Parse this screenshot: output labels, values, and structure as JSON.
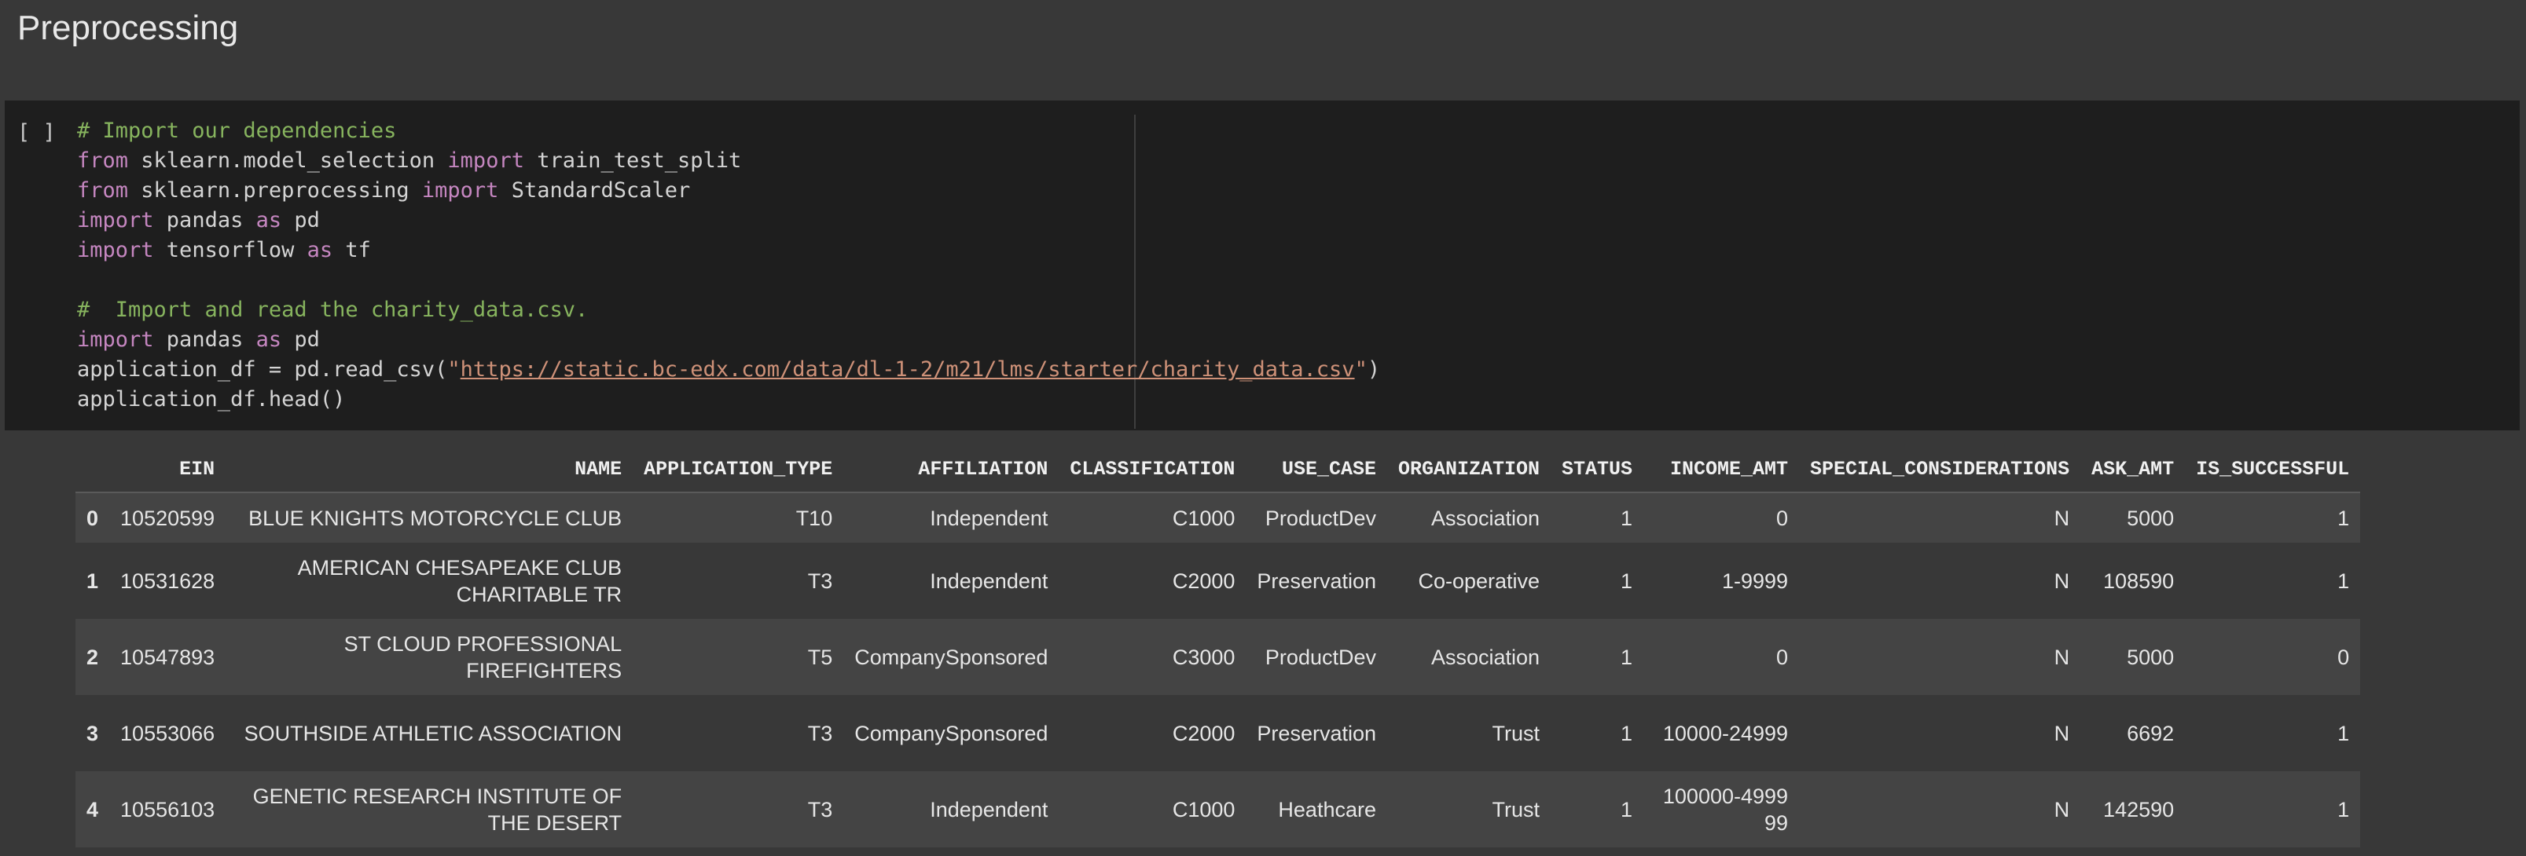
{
  "section": {
    "title": "Preprocessing"
  },
  "cell": {
    "run_indicator": "[ ]",
    "code_lines": [
      [
        {
          "t": "comment",
          "v": "# Import our dependencies"
        }
      ],
      [
        {
          "t": "kw",
          "v": "from"
        },
        {
          "t": "plain",
          "v": " sklearn.model_selection "
        },
        {
          "t": "kw",
          "v": "import"
        },
        {
          "t": "plain",
          "v": " train_test_split"
        }
      ],
      [
        {
          "t": "kw",
          "v": "from"
        },
        {
          "t": "plain",
          "v": " sklearn.preprocessing "
        },
        {
          "t": "kw",
          "v": "import"
        },
        {
          "t": "plain",
          "v": " StandardScaler"
        }
      ],
      [
        {
          "t": "kw",
          "v": "import"
        },
        {
          "t": "plain",
          "v": " pandas "
        },
        {
          "t": "kw",
          "v": "as"
        },
        {
          "t": "plain",
          "v": " pd"
        }
      ],
      [
        {
          "t": "kw",
          "v": "import"
        },
        {
          "t": "plain",
          "v": " tensorflow "
        },
        {
          "t": "kw",
          "v": "as"
        },
        {
          "t": "plain",
          "v": " tf"
        }
      ],
      [],
      [
        {
          "t": "comment",
          "v": "#  Import and read the charity_data.csv."
        }
      ],
      [
        {
          "t": "kw",
          "v": "import"
        },
        {
          "t": "plain",
          "v": " pandas "
        },
        {
          "t": "kw",
          "v": "as"
        },
        {
          "t": "plain",
          "v": " pd"
        }
      ],
      [
        {
          "t": "plain",
          "v": "application_df = pd.read_csv("
        },
        {
          "t": "str",
          "v": "\""
        },
        {
          "t": "url",
          "v": "https://static.bc-edx.com/data/dl-1-2/m21/lms/starter/charity_data.csv"
        },
        {
          "t": "str",
          "v": "\""
        },
        {
          "t": "plain",
          "v": ")"
        }
      ],
      [
        {
          "t": "plain",
          "v": "application_df.head()"
        }
      ]
    ]
  },
  "output": {
    "columns": [
      "",
      "EIN",
      "NAME",
      "APPLICATION_TYPE",
      "AFFILIATION",
      "CLASSIFICATION",
      "USE_CASE",
      "ORGANIZATION",
      "STATUS",
      "INCOME_AMT",
      "SPECIAL_CONSIDERATIONS",
      "ASK_AMT",
      "IS_SUCCESSFUL"
    ],
    "rows": [
      [
        "0",
        "10520599",
        "BLUE KNIGHTS MOTORCYCLE CLUB",
        "T10",
        "Independent",
        "C1000",
        "ProductDev",
        "Association",
        "1",
        "0",
        "N",
        "5000",
        "1"
      ],
      [
        "1",
        "10531628",
        "AMERICAN CHESAPEAKE CLUB CHARITABLE TR",
        "T3",
        "Independent",
        "C2000",
        "Preservation",
        "Co-operative",
        "1",
        "1-9999",
        "N",
        "108590",
        "1"
      ],
      [
        "2",
        "10547893",
        "ST CLOUD PROFESSIONAL FIREFIGHTERS",
        "T5",
        "CompanySponsored",
        "C3000",
        "ProductDev",
        "Association",
        "1",
        "0",
        "N",
        "5000",
        "0"
      ],
      [
        "3",
        "10553066",
        "SOUTHSIDE ATHLETIC ASSOCIATION",
        "T3",
        "CompanySponsored",
        "C2000",
        "Preservation",
        "Trust",
        "1",
        "10000-24999",
        "N",
        "6692",
        "1"
      ],
      [
        "4",
        "10556103",
        "GENETIC RESEARCH INSTITUTE OF THE DESERT",
        "T3",
        "Independent",
        "C1000",
        "Heathcare",
        "Trust",
        "1",
        "100000-499999",
        "N",
        "142590",
        "1"
      ]
    ],
    "wrapped_rows": [
      false,
      true,
      true,
      true,
      true
    ]
  }
}
